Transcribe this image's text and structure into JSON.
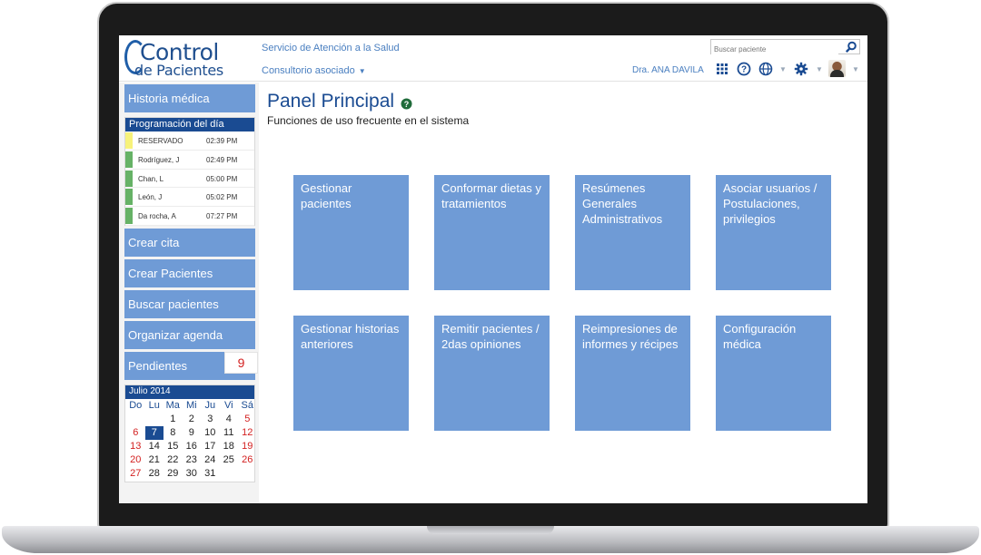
{
  "header": {
    "logo_line1": "Control",
    "logo_line2": "de Pacientes",
    "service": "Servicio de Atención a la Salud",
    "consultorio": "Consultorio asociado",
    "consultorio_caret": "▼",
    "search_placeholder": "Buscar paciente",
    "doctor": "Dra. ANA DAVILA",
    "caret": "▼"
  },
  "sidebar": {
    "historia": "Historia médica",
    "schedule_title": "Programación del día",
    "schedule": [
      {
        "name": "RESERVADO",
        "time": "02:39 PM",
        "color": "#f7f27a"
      },
      {
        "name": "Rodríguez, J",
        "time": "02:49 PM",
        "color": "#66b266"
      },
      {
        "name": "Chan, L",
        "time": "05:00 PM",
        "color": "#66b266"
      },
      {
        "name": "León, J",
        "time": "05:02 PM",
        "color": "#66b266"
      },
      {
        "name": "Da rocha, A",
        "time": "07:27 PM",
        "color": "#66b266"
      }
    ],
    "crear_cita": "Crear cita",
    "crear_pacientes": "Crear Pacientes",
    "buscar_pacientes": "Buscar pacientes",
    "organizar_agenda": "Organizar agenda",
    "pendientes": "Pendientes",
    "pendientes_count": "9"
  },
  "calendar": {
    "month": "Julio 2014",
    "days_of_week": [
      "Do",
      "Lu",
      "Ma",
      "Mi",
      "Ju",
      "Vi",
      "Sá"
    ],
    "weeks": [
      [
        "",
        "",
        "1",
        "2",
        "3",
        "4",
        "5"
      ],
      [
        "6",
        "7",
        "8",
        "9",
        "10",
        "11",
        "12"
      ],
      [
        "13",
        "14",
        "15",
        "16",
        "17",
        "18",
        "19"
      ],
      [
        "20",
        "21",
        "22",
        "23",
        "24",
        "25",
        "26"
      ],
      [
        "27",
        "28",
        "29",
        "30",
        "31",
        "",
        ""
      ]
    ],
    "today": "7"
  },
  "main": {
    "title": "Panel Principal",
    "subtitle": "Funciones de uso frecuente en el sistema",
    "tiles": [
      "Gestionar pacientes",
      "Conformar dietas y tratamientos",
      "Resúmenes Generales Administrativos",
      "Asociar usuarios / Postulaciones, privilegios",
      "Gestionar historias anteriores",
      "Remitir pacientes / 2das opiniones",
      "Reimpresiones de informes y récipes",
      "Configuración médica"
    ]
  },
  "colors": {
    "accent": "#1a4b92",
    "tile": "#6f9bd6",
    "weekend": "#d32020"
  },
  "icons": [
    "search-icon",
    "apps-grid-icon",
    "help-icon",
    "globe-icon",
    "gear-icon",
    "avatar"
  ]
}
